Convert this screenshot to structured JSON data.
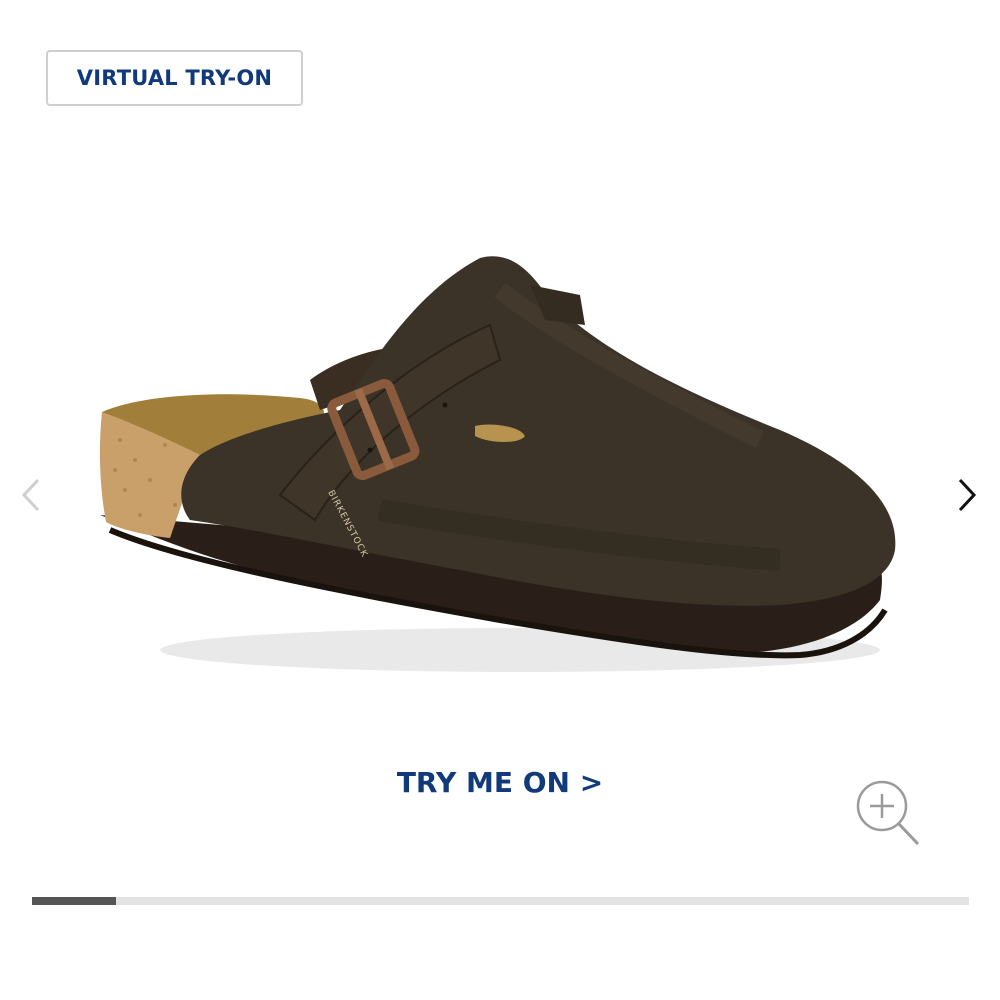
{
  "virtual_try_on": {
    "label": "VIRTUAL TRY-ON"
  },
  "product": {
    "image_icon": "clog-shoe-image",
    "buckle_imprint": "BIRKENSTOCK"
  },
  "carousel": {
    "prev_icon": "chevron-left-icon",
    "next_icon": "chevron-right-icon",
    "progress_fraction": 0.09
  },
  "cta": {
    "label": "TRY ME ON >"
  },
  "zoom": {
    "icon": "zoom-in-icon"
  },
  "colors": {
    "brand_blue": "#113a7a",
    "progress_fill": "#555555",
    "progress_track": "#e3e3e3",
    "border_gray": "#cfcfcf"
  }
}
